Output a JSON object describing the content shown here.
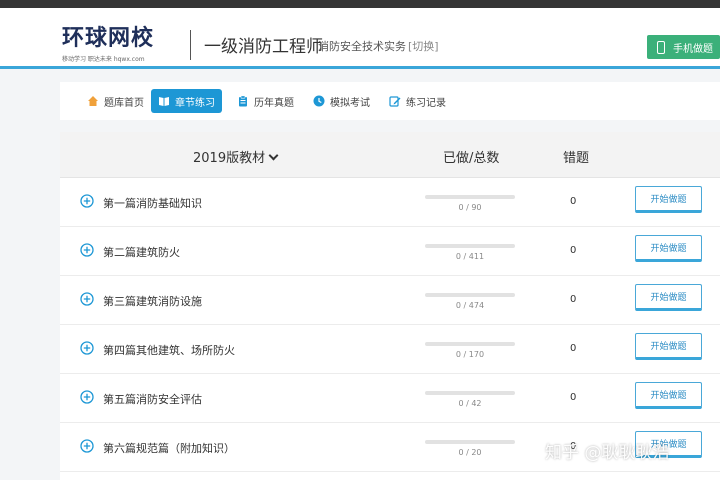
{
  "header": {
    "logo_text": "环球网校",
    "logo_tagline": "移动学习 职达未来 hqwx.com",
    "exam_title": "一级消防工程师",
    "exam_subject": "消防安全技术实务",
    "switch_label": "[切换]",
    "mobile_button_label": "手机做题"
  },
  "nav": {
    "items": [
      {
        "label": "题库首页",
        "icon": "home-icon"
      },
      {
        "label": "章节练习",
        "icon": "book-icon",
        "active": true
      },
      {
        "label": "历年真题",
        "icon": "clipboard-icon"
      },
      {
        "label": "模拟考试",
        "icon": "clock-icon"
      },
      {
        "label": "练习记录",
        "icon": "pencil-icon"
      }
    ]
  },
  "table": {
    "headers": {
      "book": "2019版教材",
      "done_total": "已做/总数",
      "wrong": "错题"
    },
    "rows": [
      {
        "name": "第一篇消防基础知识",
        "progress": "0 / 90",
        "done": 0,
        "total": 90,
        "wrong": "0",
        "button": "开始做题"
      },
      {
        "name": "第二篇建筑防火",
        "progress": "0 / 411",
        "done": 0,
        "total": 411,
        "wrong": "0",
        "button": "开始做题"
      },
      {
        "name": "第三篇建筑消防设施",
        "progress": "0 / 474",
        "done": 0,
        "total": 474,
        "wrong": "0",
        "button": "开始做题"
      },
      {
        "name": "第四篇其他建筑、场所防火",
        "progress": "0 / 170",
        "done": 0,
        "total": 170,
        "wrong": "0",
        "button": "开始做题"
      },
      {
        "name": "第五篇消防安全评估",
        "progress": "0 / 42",
        "done": 0,
        "total": 42,
        "wrong": "0",
        "button": "开始做题"
      },
      {
        "name": "第六篇规范篇（附加知识）",
        "progress": "0 / 20",
        "done": 0,
        "total": 20,
        "wrong": "0",
        "button": "开始做题"
      }
    ]
  },
  "watermark": "知乎 @耿耿耿浩",
  "colors": {
    "accent": "#1d97d5",
    "header_line": "#3aa6d9",
    "mobile_button": "#3bb07a",
    "topbar": "#353535"
  }
}
